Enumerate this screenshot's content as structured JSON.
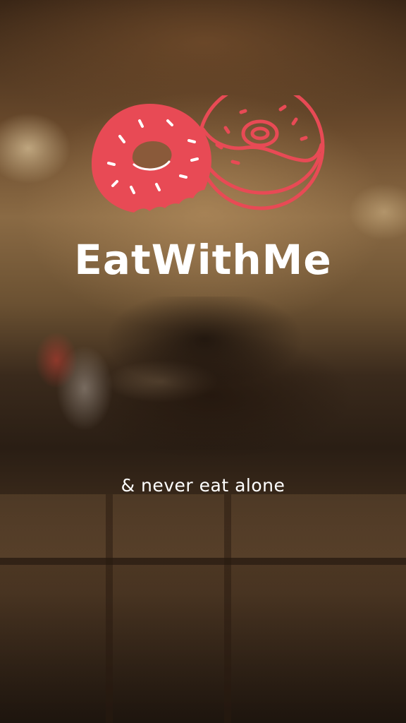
{
  "app": {
    "title": "EatWithMe",
    "tagline": "& never eat alone"
  },
  "background": {
    "description_icon": "restaurant-background-image"
  },
  "logo": {
    "icon": "donuts-logo-icon",
    "accent_color": "#e84a55"
  }
}
